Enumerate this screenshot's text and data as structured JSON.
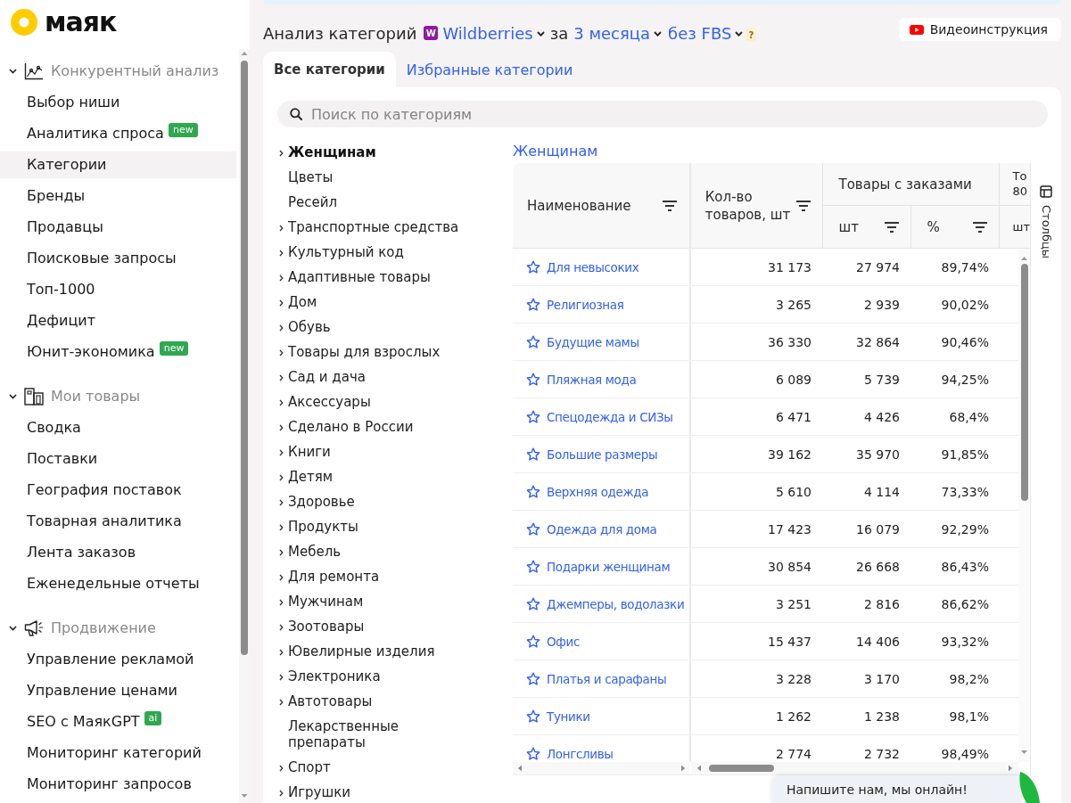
{
  "logo": {
    "text": "маяк"
  },
  "sidebar": {
    "groups": [
      {
        "title": "Конкурентный анализ",
        "expanded": true,
        "items": [
          {
            "label": "Выбор ниши",
            "selected": false
          },
          {
            "label": "Аналитика спроса",
            "selected": false,
            "badge": "new"
          },
          {
            "label": "Категории",
            "selected": true
          },
          {
            "label": "Бренды",
            "selected": false
          },
          {
            "label": "Продавцы",
            "selected": false
          },
          {
            "label": "Поисковые запросы",
            "selected": false
          },
          {
            "label": "Топ-1000",
            "selected": false
          },
          {
            "label": "Дефицит",
            "selected": false
          },
          {
            "label": "Юнит-экономика",
            "selected": false,
            "badge": "new"
          }
        ]
      },
      {
        "title": "Мои товары",
        "expanded": true,
        "items": [
          {
            "label": "Сводка",
            "selected": false
          },
          {
            "label": "Поставки",
            "selected": false
          },
          {
            "label": "География поставок",
            "selected": false
          },
          {
            "label": "Товарная аналитика",
            "selected": false
          },
          {
            "label": "Лента заказов",
            "selected": false
          },
          {
            "label": "Еженедельные отчеты",
            "selected": false
          }
        ]
      },
      {
        "title": "Продвижение",
        "expanded": true,
        "items": [
          {
            "label": "Управление рекламой",
            "selected": false
          },
          {
            "label": "Управление ценами",
            "selected": false
          },
          {
            "label": "SEO с МаякGPT",
            "selected": false,
            "badge": "ai"
          },
          {
            "label": "Мониторинг категорий",
            "selected": false
          },
          {
            "label": "Мониторинг запросов",
            "selected": false
          }
        ]
      }
    ]
  },
  "header": {
    "title": "Анализ категорий",
    "marketplace": {
      "logo_letter": "W",
      "name": "Wildberries"
    },
    "connector": "за",
    "period": "3 месяца",
    "mode": "без FBS",
    "help": "?",
    "video_button": "Видеоинструкция"
  },
  "tabs": [
    {
      "label": "Все категории",
      "selected": true
    },
    {
      "label": "Избранные категории",
      "selected": false
    }
  ],
  "search": {
    "placeholder": "Поиск по категориям"
  },
  "category_tree": [
    {
      "label": "Женщинам",
      "expandable": true,
      "selected": true
    },
    {
      "label": "Цветы",
      "expandable": false,
      "selected": false
    },
    {
      "label": "Ресейл",
      "expandable": false,
      "selected": false
    },
    {
      "label": "Транспортные средства",
      "expandable": true,
      "selected": false
    },
    {
      "label": "Культурный код",
      "expandable": true,
      "selected": false
    },
    {
      "label": "Адаптивные товары",
      "expandable": true,
      "selected": false
    },
    {
      "label": "Дом",
      "expandable": true,
      "selected": false
    },
    {
      "label": "Обувь",
      "expandable": true,
      "selected": false
    },
    {
      "label": "Товары для взрослых",
      "expandable": true,
      "selected": false
    },
    {
      "label": "Сад и дача",
      "expandable": true,
      "selected": false
    },
    {
      "label": "Аксессуары",
      "expandable": true,
      "selected": false
    },
    {
      "label": "Сделано в России",
      "expandable": true,
      "selected": false
    },
    {
      "label": "Книги",
      "expandable": true,
      "selected": false
    },
    {
      "label": "Детям",
      "expandable": true,
      "selected": false
    },
    {
      "label": "Здоровье",
      "expandable": true,
      "selected": false
    },
    {
      "label": "Продукты",
      "expandable": true,
      "selected": false
    },
    {
      "label": "Мебель",
      "expandable": true,
      "selected": false
    },
    {
      "label": "Для ремонта",
      "expandable": true,
      "selected": false
    },
    {
      "label": "Мужчинам",
      "expandable": true,
      "selected": false
    },
    {
      "label": "Зоотовары",
      "expandable": true,
      "selected": false
    },
    {
      "label": "Ювелирные изделия",
      "expandable": true,
      "selected": false
    },
    {
      "label": "Электроника",
      "expandable": true,
      "selected": false
    },
    {
      "label": "Автотовары",
      "expandable": true,
      "selected": false
    },
    {
      "label": "Лекарственные препараты",
      "expandable": false,
      "selected": false
    },
    {
      "label": "Спорт",
      "expandable": true,
      "selected": false
    },
    {
      "label": "Игрушки",
      "expandable": true,
      "selected": false
    }
  ],
  "breadcrumb": "Женщинам",
  "table": {
    "header": {
      "name": "Наименование",
      "count": "Кол-во товаров, шт",
      "orders_group": "Товары с заказами",
      "orders_units": "шт",
      "orders_percent": "%",
      "column_5_lines": [
        "То",
        "80"
      ],
      "column_5_unit": "шт"
    },
    "rows": [
      {
        "name": "Для невысоких",
        "favorite": false,
        "products": "31 173",
        "with_orders": "27 974",
        "with_orders_percent": "89,74%"
      },
      {
        "name": "Религиозная",
        "favorite": false,
        "products": "3 265",
        "with_orders": "2 939",
        "with_orders_percent": "90,02%"
      },
      {
        "name": "Будущие мамы",
        "favorite": false,
        "products": "36 330",
        "with_orders": "32 864",
        "with_orders_percent": "90,46%"
      },
      {
        "name": "Пляжная мода",
        "favorite": false,
        "products": "6 089",
        "with_orders": "5 739",
        "with_orders_percent": "94,25%"
      },
      {
        "name": "Спецодежда и СИЗы",
        "favorite": false,
        "products": "6 471",
        "with_orders": "4 426",
        "with_orders_percent": "68,4%"
      },
      {
        "name": "Большие размеры",
        "favorite": false,
        "products": "39 162",
        "with_orders": "35 970",
        "with_orders_percent": "91,85%"
      },
      {
        "name": "Верхняя одежда",
        "favorite": false,
        "products": "5 610",
        "with_orders": "4 114",
        "with_orders_percent": "73,33%"
      },
      {
        "name": "Одежда для дома",
        "favorite": false,
        "products": "17 423",
        "with_orders": "16 079",
        "with_orders_percent": "92,29%"
      },
      {
        "name": "Подарки женщинам",
        "favorite": false,
        "products": "30 854",
        "with_orders": "26 668",
        "with_orders_percent": "86,43%"
      },
      {
        "name": "Джемперы, водолазки",
        "favorite": false,
        "products": "3 251",
        "with_orders": "2 816",
        "with_orders_percent": "86,62%"
      },
      {
        "name": "Офис",
        "favorite": false,
        "products": "15 437",
        "with_orders": "14 406",
        "with_orders_percent": "93,32%"
      },
      {
        "name": "Платья и сарафаны",
        "favorite": false,
        "products": "3 228",
        "with_orders": "3 170",
        "with_orders_percent": "98,2%"
      },
      {
        "name": "Туники",
        "favorite": false,
        "products": "1 262",
        "with_orders": "1 238",
        "with_orders_percent": "98,1%"
      },
      {
        "name": "Лонгсливы",
        "favorite": false,
        "products": "2 774",
        "with_orders": "2 732",
        "with_orders_percent": "98,49%"
      }
    ]
  },
  "columns_panel": {
    "label": "Столбцы"
  },
  "chat_widget": {
    "text": "Напишите нам, мы онлайн!"
  }
}
